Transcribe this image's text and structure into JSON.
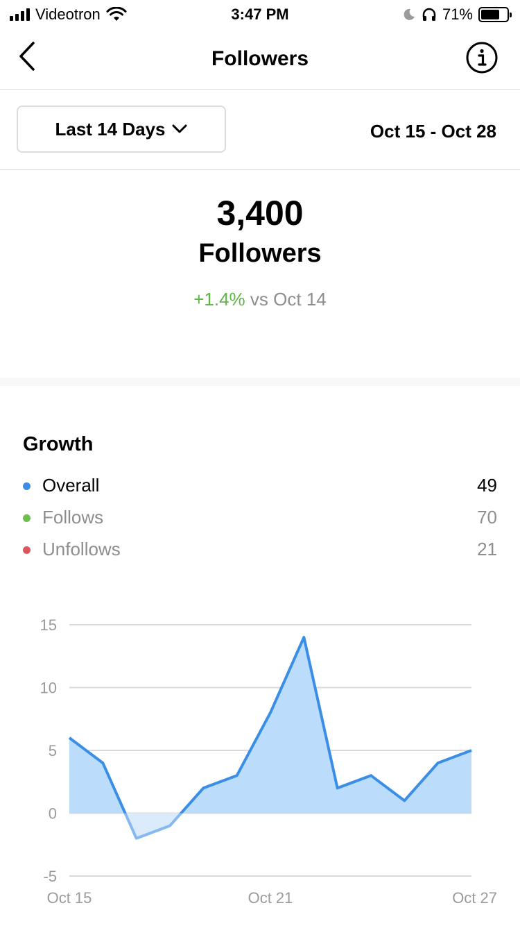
{
  "status_bar": {
    "carrier": "Videotron",
    "time": "3:47 PM",
    "battery": "71%",
    "battery_level": 0.71
  },
  "nav": {
    "title": "Followers",
    "back_icon": "chevron-left-icon",
    "info_icon": "info-icon"
  },
  "filter": {
    "range_label": "Last 14 Days",
    "date_range": "Oct 15 - Oct 28"
  },
  "summary": {
    "count": "3,400",
    "label": "Followers",
    "change": "+1.4%",
    "compare_text": "vs Oct 14"
  },
  "growth": {
    "title": "Growth",
    "legend": [
      {
        "name": "Overall",
        "value": "49",
        "color": "#3b8ee6"
      },
      {
        "name": "Follows",
        "value": "70",
        "color": "#6cc04a"
      },
      {
        "name": "Unfollows",
        "value": "21",
        "color": "#e0555a"
      }
    ]
  },
  "colors": {
    "line": "#3b8ee6",
    "fill_positive": "#bcdcfb",
    "fill_negative": "#dcebfb",
    "grid": "#d9d9d9",
    "positive_change": "#5fb548"
  },
  "chart_data": {
    "type": "area",
    "x": [
      "Oct 15",
      "Oct 16",
      "Oct 17",
      "Oct 18",
      "Oct 19",
      "Oct 20",
      "Oct 21",
      "Oct 22",
      "Oct 23",
      "Oct 24",
      "Oct 25",
      "Oct 26",
      "Oct 27"
    ],
    "series": [
      {
        "name": "Overall",
        "values": [
          6,
          4,
          -2,
          -1,
          2,
          3,
          8,
          14,
          2,
          3,
          1,
          4,
          5
        ]
      }
    ],
    "x_tick_labels": [
      "Oct 15",
      "Oct 21",
      "Oct 27"
    ],
    "y_ticks": [
      15,
      10,
      5,
      0,
      -5
    ],
    "ylim": [
      -5,
      15
    ],
    "grid": true
  }
}
